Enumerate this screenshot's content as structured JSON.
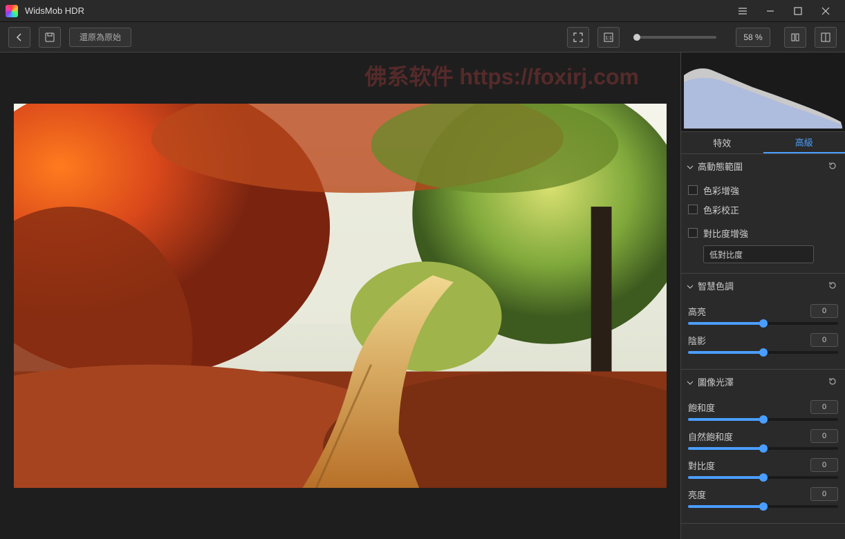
{
  "titlebar": {
    "app_name": "WidsMob HDR"
  },
  "toolbar": {
    "reset_label": "還原為原始",
    "zoom_value": "58 %"
  },
  "tabs": {
    "effects": "特效",
    "advanced": "高級"
  },
  "sections": {
    "hdrRange": {
      "title": "高動態範圍",
      "color_enhance": "色彩增強",
      "color_correct": "色彩校正",
      "contrast_enhance": "對比度增強",
      "contrast_select": "低對比度"
    },
    "smartTone": {
      "title": "智慧色調",
      "highlight": {
        "label": "高亮",
        "value": "0",
        "pos": 50
      },
      "shadow": {
        "label": "陰影",
        "value": "0",
        "pos": 50
      }
    },
    "imageGloss": {
      "title": "圖像光澤",
      "saturation": {
        "label": "飽和度",
        "value": "0",
        "pos": 50
      },
      "vibrance": {
        "label": "自然飽和度",
        "value": "0",
        "pos": 50
      },
      "contrast": {
        "label": "對比度",
        "value": "0",
        "pos": 50
      },
      "brightness": {
        "label": "亮度",
        "value": "0",
        "pos": 50
      }
    }
  },
  "watermark": "佛系软件 https://foxirj.com"
}
